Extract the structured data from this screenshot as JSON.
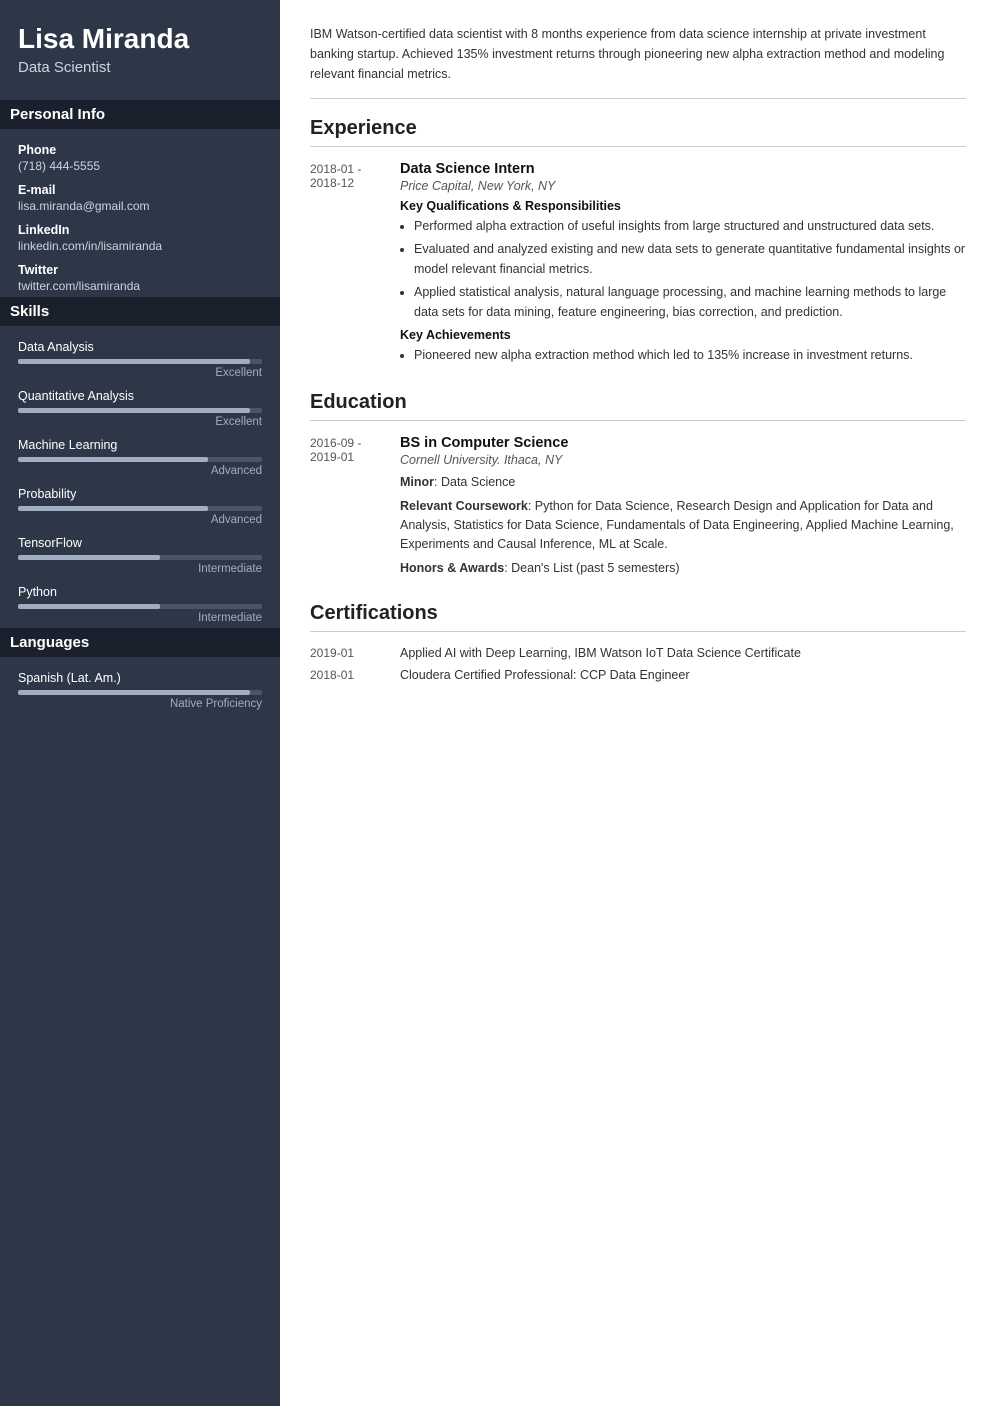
{
  "sidebar": {
    "name": "Lisa Miranda",
    "title": "Data Scientist",
    "personal_info_label": "Personal Info",
    "phone_label": "Phone",
    "phone_value": "(718) 444-5555",
    "email_label": "E-mail",
    "email_value": "lisa.miranda@gmail.com",
    "linkedin_label": "LinkedIn",
    "linkedin_value": "linkedin.com/in/lisamiranda",
    "twitter_label": "Twitter",
    "twitter_value": "twitter.com/lisamiranda",
    "skills_label": "Skills",
    "skills": [
      {
        "name": "Data Analysis",
        "level": "Excellent",
        "pct": 95
      },
      {
        "name": "Quantitative Analysis",
        "level": "Excellent",
        "pct": 95
      },
      {
        "name": "Machine Learning",
        "level": "Advanced",
        "pct": 78
      },
      {
        "name": "Probability",
        "level": "Advanced",
        "pct": 78
      },
      {
        "name": "TensorFlow",
        "level": "Intermediate",
        "pct": 58
      },
      {
        "name": "Python",
        "level": "Intermediate",
        "pct": 58
      }
    ],
    "languages_label": "Languages",
    "languages": [
      {
        "name": "Spanish (Lat. Am.)",
        "level": "Native Proficiency",
        "pct": 95
      }
    ]
  },
  "main": {
    "summary": "IBM Watson-certified data scientist with 8 months experience from data science internship at private investment banking startup. Achieved 135% investment returns through pioneering new alpha extraction method and modeling relevant financial metrics.",
    "experience_label": "Experience",
    "experience": [
      {
        "date": "2018-01 -\n2018-12",
        "title": "Data Science Intern",
        "subtitle": "Price Capital, New York, NY",
        "kq_label": "Key Qualifications & Responsibilities",
        "bullets": [
          "Performed alpha extraction of useful insights from large structured and unstructured data sets.",
          "Evaluated and analyzed existing and new data sets to generate quantitative fundamental insights or model relevant financial metrics.",
          "Applied statistical analysis, natural language processing, and machine learning methods to large data sets for data mining, feature engineering, bias correction, and prediction."
        ],
        "ka_label": "Key Achievements",
        "achievements": [
          "Pioneered new alpha extraction method which led to 135% increase in investment returns."
        ]
      }
    ],
    "education_label": "Education",
    "education": [
      {
        "date": "2016-09 -\n2019-01",
        "title": "BS in Computer Science",
        "subtitle": "Cornell University. Ithaca, NY",
        "minor_label": "Minor",
        "minor_value": "Data Science",
        "coursework_label": "Relevant Coursework",
        "coursework_value": "Python for Data Science, Research Design and Application for Data and Analysis, Statistics for Data Science, Fundamentals of Data Engineering, Applied Machine Learning, Experiments and Causal Inference, ML at Scale.",
        "honors_label": "Honors & Awards",
        "honors_value": "Dean's List (past 5 semesters)"
      }
    ],
    "certifications_label": "Certifications",
    "certifications": [
      {
        "date": "2019-01",
        "text": "Applied AI with Deep Learning, IBM Watson IoT Data Science Certificate"
      },
      {
        "date": "2018-01",
        "text": "Cloudera Certified Professional: CCP Data Engineer"
      }
    ]
  }
}
